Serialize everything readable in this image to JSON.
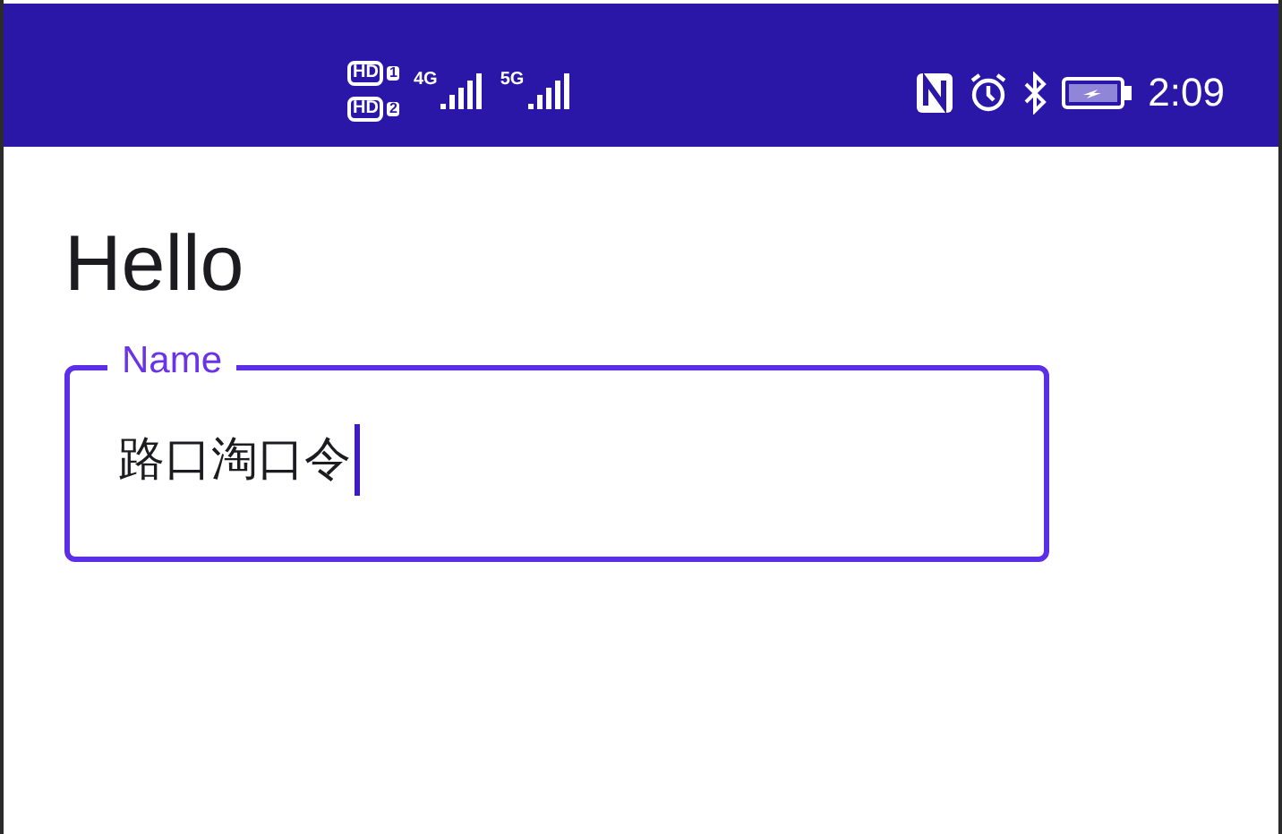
{
  "status_bar": {
    "sims": [
      {
        "badge": "HD",
        "slot": "1",
        "network": "4G"
      },
      {
        "badge": "HD",
        "slot": "2",
        "network": "5G"
      }
    ],
    "time": "2:09"
  },
  "title": "Hello",
  "field": {
    "label": "Name",
    "value": "路口淘口令",
    "focused": true
  }
}
